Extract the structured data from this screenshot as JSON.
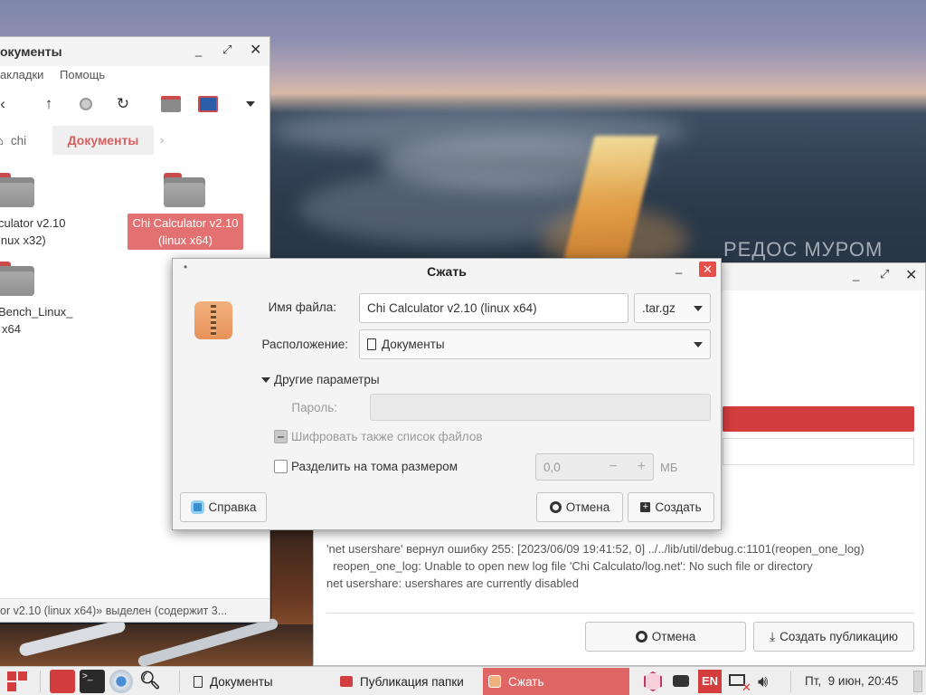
{
  "colors": {
    "accent": "#d95f5f",
    "close_red": "#e45049",
    "selected_bg": "#e37171",
    "progress_red": "#d33d3d"
  },
  "file_manager": {
    "title": "окументы",
    "menu": [
      "акладки",
      "Помощь"
    ],
    "toolbar_icons": [
      "back-icon",
      "up-arrow-icon",
      "record-icon",
      "refresh-icon",
      "home-folder-icon",
      "display-icon",
      "chevron-down-icon"
    ],
    "breadcrumb": {
      "home_label": "chi",
      "current": "Документы"
    },
    "items": [
      {
        "label_line1": "culator v2.10",
        "label_line2": "inux x32)",
        "selected": false
      },
      {
        "label_line1": "Chi Calculator v2.10",
        "label_line2": "(linux x64)",
        "selected": true
      },
      {
        "label_line1": "Bench_Linux_",
        "label_line2": "x64",
        "selected": false
      }
    ],
    "status": "or v2.10 (linux x64)» выделен (содержит 3..."
  },
  "share_window": {
    "log_lines": [
      "'net usershare' вернул ошибку 255: [2023/06/09 19:41:52,  0] ../../lib/util/debug.c:1101(reopen_one_log)",
      "  reopen_one_log: Unable to open new log file 'Chi Calculato/log.net': No such file or directory",
      "net usershare: usershares are currently disabled"
    ],
    "cancel_label": "Отмена",
    "create_share_label": "Создать публикацию"
  },
  "dialog": {
    "title": "Сжать",
    "filename_label": "Имя файла:",
    "filename_value": "Chi Calculator v2.10 (linux x64)",
    "extension": ".tar.gz",
    "location_label": "Расположение:",
    "location_value": "Документы",
    "other_options": "Другие параметры",
    "password_label": "Пароль:",
    "password_value": "",
    "encrypt_list_label": "Шифровать также список файлов",
    "split_label": "Разделить на тома размером",
    "split_value": "0,0",
    "split_unit": "МБ",
    "help_label": "Справка",
    "cancel_label": "Отмена",
    "create_label": "Создать"
  },
  "wallpaper": {
    "watermark": "РЕДОС МУРОМ"
  },
  "taskbar": {
    "tasks": [
      {
        "label": "Документы",
        "active": false
      },
      {
        "label": "Публикация папки",
        "active": false
      },
      {
        "label": "Сжать",
        "active": true
      }
    ],
    "keyboard_layout": "EN",
    "clock": "Пт,  9 июн, 20:45"
  }
}
